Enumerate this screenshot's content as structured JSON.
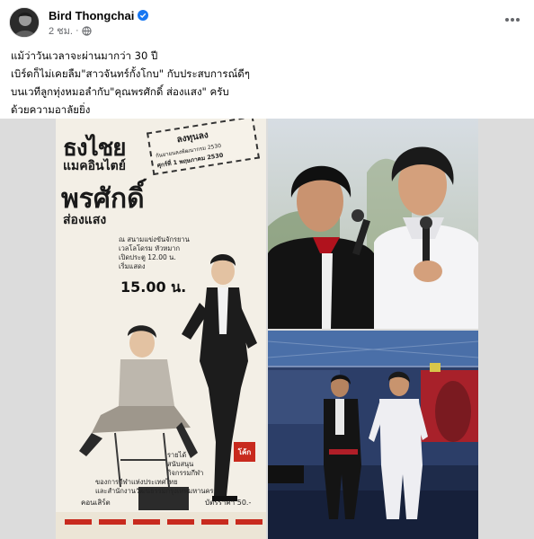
{
  "post": {
    "author": "Bird Thongchai",
    "time": "2 ชม.",
    "separator": "·",
    "more_icon": "more-horizontal-icon",
    "privacy_icon": "globe-icon",
    "verified_icon": "verified-badge-icon"
  },
  "caption": {
    "line1": "แม้ว่าวันเวลาจะผ่านมากว่า 30 ปี",
    "line2": "เบิร์ดก็ไม่เคยลืม\"สาวจันทร์กั้งโกบ\" กับประสบการณ์ดีๆ",
    "line3": "บนเวทีลูกทุ่งหมอลำกับ\"คุณพรศักดิ์ ส่องแสง\" ครับ",
    "line4": "ด้วยความอาลัยยิ่ง"
  },
  "poster": {
    "title_1": "ธงไชย",
    "title_2": "แมคอินไตย์",
    "title_3": "พรศักดิ์",
    "title_4": "ส่องแสง",
    "ticket_line1": "ลงทุนลง",
    "ticket_line2": "กันยายนลงพัฒนากรม 2530",
    "ticket_line3": "ศุกร์ที่ 1 พฤษภาคม 2530",
    "venue_line1": "ณ สนามแข่งขันจักรยาน",
    "venue_line2": "เวลโลโดรม หัวหมาก",
    "venue_line3": "เปิดประตู 12.00 น.",
    "venue_line4": "เริ่มแสดง",
    "show_time": "15.00 น.",
    "info_line1": "รายได้",
    "info_line2": "สนับสนุน",
    "info_line3": "กิจกรรมกีฬา",
    "info_line4": "ของการกีฬาแห่งประเทศไทย",
    "info_line5": "และสำนักงานวัฒนธรรมกรุงเทพมหานคร",
    "concert_label": "คอนเสิร์ต",
    "price_label": "บัตรราคา  50.-",
    "logo_text": "โค้ก"
  },
  "colors": {
    "accent": "#1877f2",
    "secondary_text": "#65676b",
    "poster_paper": "#f3efe6",
    "poster_red": "#c82a1e"
  }
}
